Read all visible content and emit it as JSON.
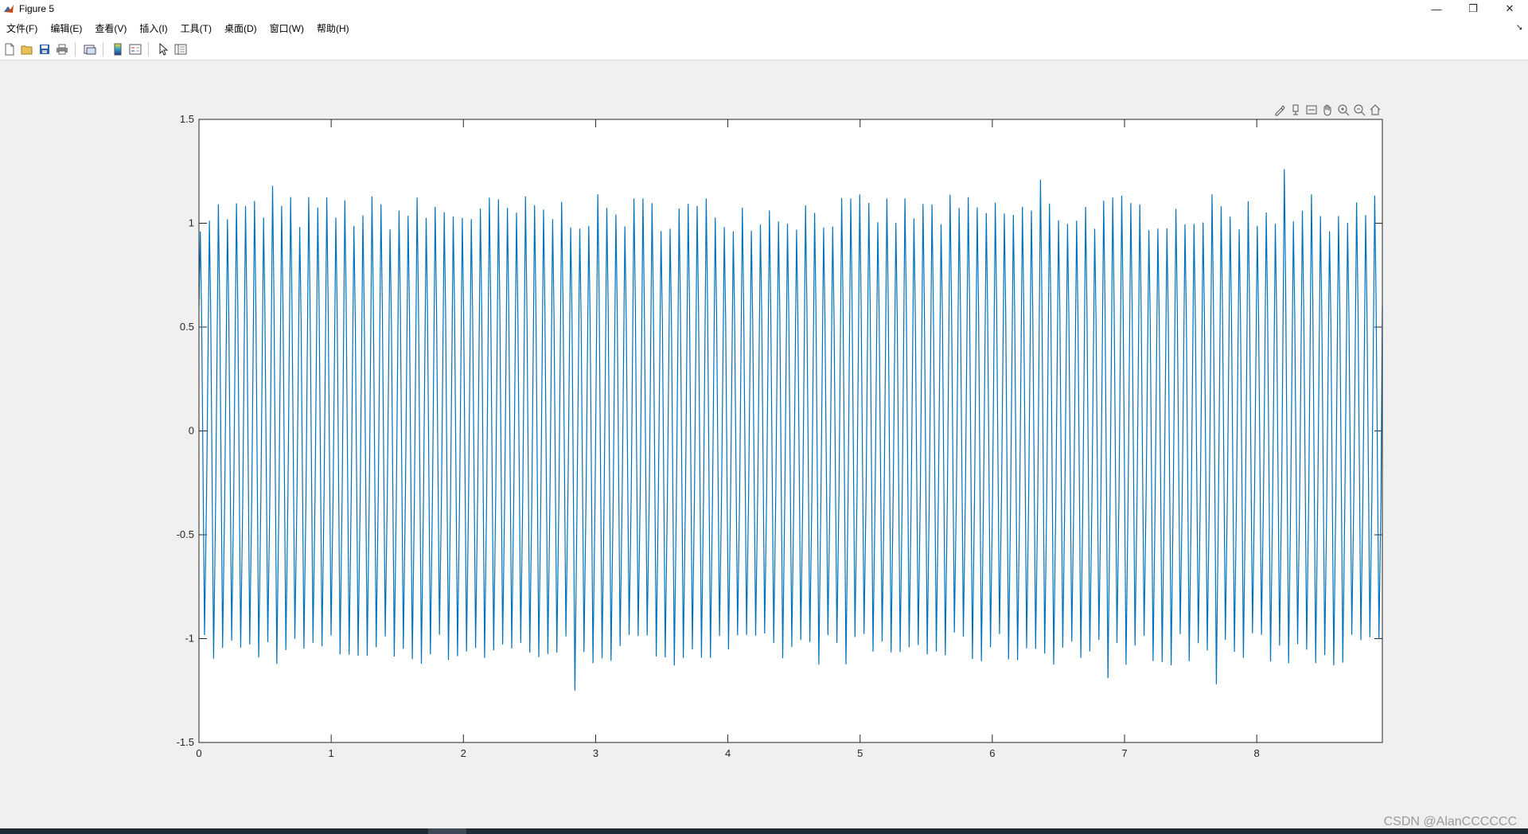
{
  "window": {
    "title": "Figure 5",
    "controls": {
      "minimize": "—",
      "restore": "❐",
      "close": "✕"
    }
  },
  "menu": {
    "items": [
      "文件(F)",
      "编辑(E)",
      "查看(V)",
      "插入(I)",
      "工具(T)",
      "桌面(D)",
      "窗口(W)",
      "帮助(H)"
    ]
  },
  "toolbar": {
    "icons": [
      "new-figure-icon",
      "open-file-icon",
      "save-icon",
      "print-icon",
      "link-plot-icon",
      "colorbar-icon",
      "legend-icon",
      "pointer-icon",
      "property-inspector-icon"
    ]
  },
  "axes_toolbar": {
    "icons": [
      "brush-icon",
      "data-tips-icon",
      "export-icon",
      "pan-icon",
      "zoom-in-icon",
      "zoom-out-icon",
      "home-icon"
    ]
  },
  "chart_data": {
    "type": "line",
    "title": "",
    "xlabel": "",
    "ylabel": "",
    "xlim": [
      0,
      8.95
    ],
    "ylim": [
      -1.5,
      1.5
    ],
    "xticks": [
      "0",
      "1",
      "2",
      "3",
      "4",
      "5",
      "6",
      "7",
      "8"
    ],
    "yticks": [
      "1.5",
      "1",
      "0.5",
      "0",
      "-0.5",
      "-1",
      "-1.5"
    ],
    "grid": false,
    "series": [
      {
        "color": "#0072BD",
        "signal": {
          "cycles": 131,
          "typical_peak": 1.05,
          "typical_trough": -1.05,
          "max_peak": 1.26,
          "min_trough": -1.25,
          "start_value": 0.6,
          "end_value": 0.6
        }
      }
    ]
  },
  "watermark": "CSDN @AlanCCCCCC",
  "colors": {
    "line": "#0072BD",
    "axes_bg": "#ffffff",
    "figure_bg": "#f0f0f0"
  }
}
